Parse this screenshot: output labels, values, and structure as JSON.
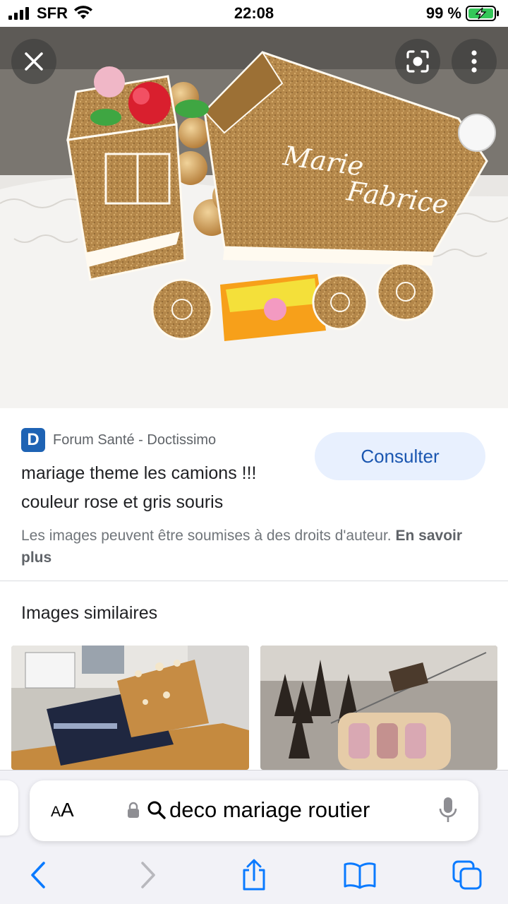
{
  "status_bar": {
    "carrier": "SFR",
    "time": "22:08",
    "battery_percent": "99 %"
  },
  "hero": {
    "icons": [
      "close-icon",
      "lens-icon",
      "more-vert-icon"
    ],
    "cake_inscription_line1": "Marie",
    "cake_inscription_line2": "Fabrice"
  },
  "result": {
    "favicon_letter": "D",
    "source_name": "Forum Santé - Doctissimo",
    "consult_label": "Consulter",
    "title": "mariage theme les camions !!! couleur rose et gris souris",
    "copyright_text": "Les images peuvent être soumises à des droits d'auteur.",
    "learn_more": "En savoir plus"
  },
  "similar": {
    "heading": "Images similaires"
  },
  "toolbar": {
    "aa_label_small": "A",
    "aa_label_large": "A",
    "address_text": "deco mariage routier",
    "icons": [
      "lock-icon",
      "search-icon",
      "microphone-icon",
      "back-icon",
      "forward-icon",
      "share-icon",
      "bookmarks-icon",
      "tabs-icon"
    ]
  },
  "colors": {
    "accent": "#1a56b0",
    "consult_bg": "#e8f0fe",
    "toolbar_bg": "#f2f2f7",
    "ios_blue": "#0a7aff"
  }
}
